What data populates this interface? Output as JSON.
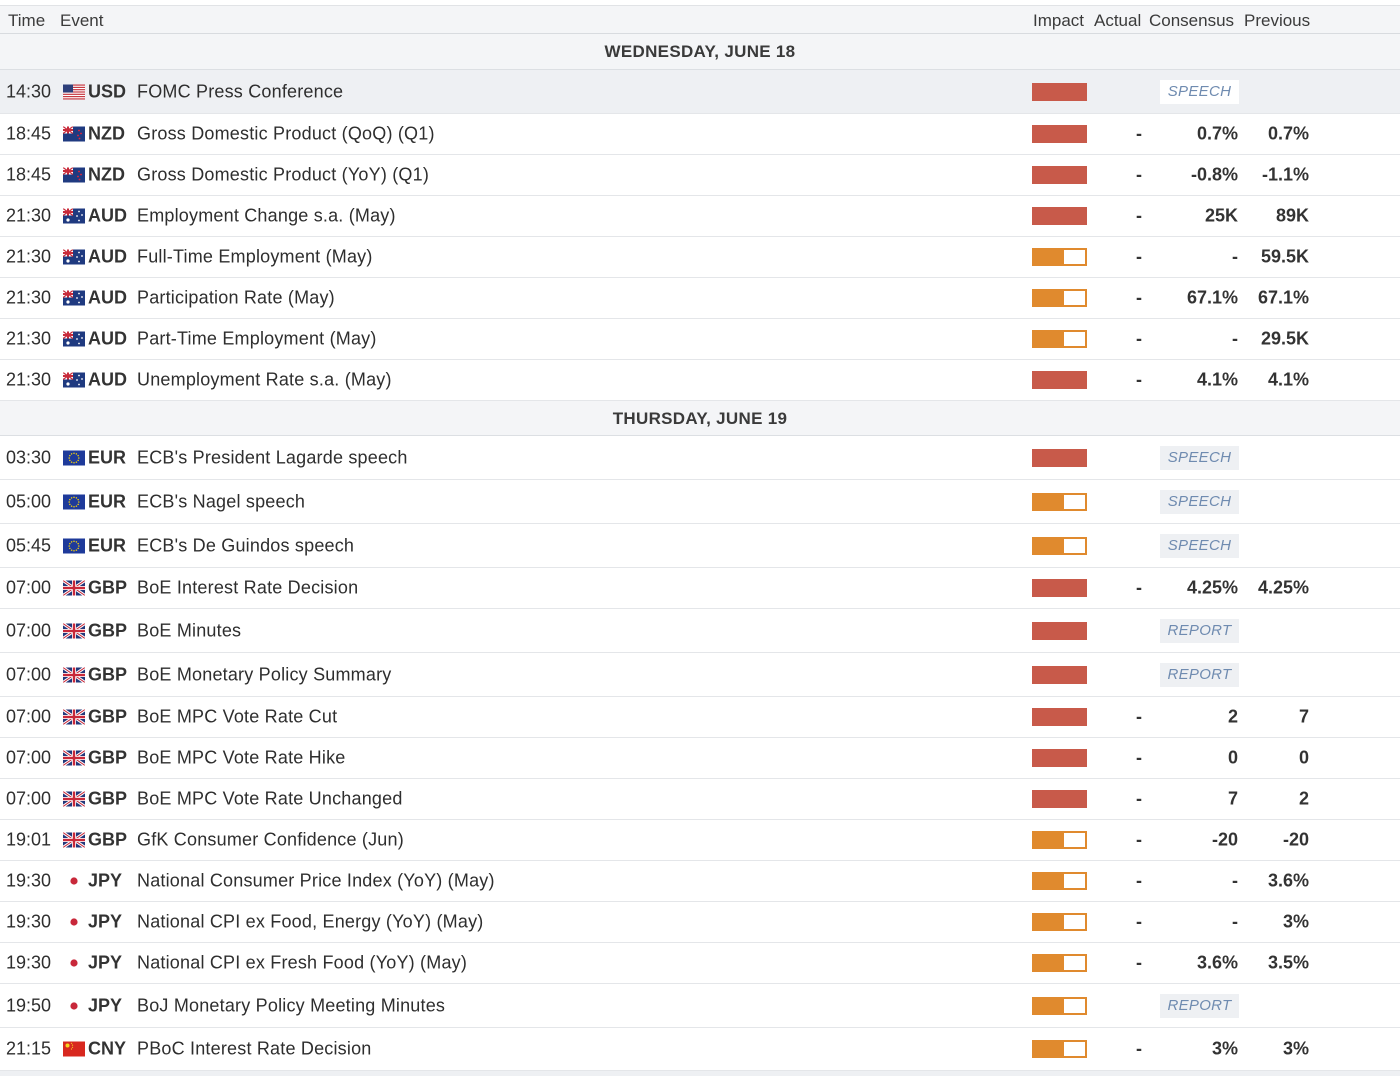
{
  "header": {
    "time": "Time",
    "event": "Event",
    "impact": "Impact",
    "actual": "Actual",
    "consensus": "Consensus",
    "previous": "Previous"
  },
  "colors": {
    "high_impact": "#c85a4a",
    "medium_impact": "#e08a2e",
    "tag_text": "#6f8bb0"
  },
  "days": [
    {
      "label": "WEDNESDAY, JUNE 18",
      "events": [
        {
          "time": "14:30",
          "flag": "us-flag-icon",
          "currency": "USD",
          "event": "FOMC Press Conference",
          "impact": "high",
          "actual": "",
          "consensus": "",
          "previous": "",
          "tag": "SPEECH",
          "highlighted": true
        },
        {
          "time": "18:45",
          "flag": "nz-flag-icon",
          "currency": "NZD",
          "event": "Gross Domestic Product (QoQ) (Q1)",
          "impact": "high",
          "actual": "-",
          "consensus": "0.7%",
          "previous": "0.7%",
          "tag": ""
        },
        {
          "time": "18:45",
          "flag": "nz-flag-icon",
          "currency": "NZD",
          "event": "Gross Domestic Product (YoY) (Q1)",
          "impact": "high",
          "actual": "-",
          "consensus": "-0.8%",
          "previous": "-1.1%",
          "tag": ""
        },
        {
          "time": "21:30",
          "flag": "au-flag-icon",
          "currency": "AUD",
          "event": "Employment Change s.a. (May)",
          "impact": "high",
          "actual": "-",
          "consensus": "25K",
          "previous": "89K",
          "tag": ""
        },
        {
          "time": "21:30",
          "flag": "au-flag-icon",
          "currency": "AUD",
          "event": "Full-Time Employment (May)",
          "impact": "medium",
          "actual": "-",
          "consensus": "-",
          "previous": "59.5K",
          "tag": ""
        },
        {
          "time": "21:30",
          "flag": "au-flag-icon",
          "currency": "AUD",
          "event": "Participation Rate (May)",
          "impact": "medium",
          "actual": "-",
          "consensus": "67.1%",
          "previous": "67.1%",
          "tag": ""
        },
        {
          "time": "21:30",
          "flag": "au-flag-icon",
          "currency": "AUD",
          "event": "Part-Time Employment (May)",
          "impact": "medium",
          "actual": "-",
          "consensus": "-",
          "previous": "29.5K",
          "tag": ""
        },
        {
          "time": "21:30",
          "flag": "au-flag-icon",
          "currency": "AUD",
          "event": "Unemployment Rate s.a. (May)",
          "impact": "high",
          "actual": "-",
          "consensus": "4.1%",
          "previous": "4.1%",
          "tag": ""
        }
      ]
    },
    {
      "label": "THURSDAY, JUNE 19",
      "events": [
        {
          "time": "03:30",
          "flag": "eu-flag-icon",
          "currency": "EUR",
          "event": "ECB's President Lagarde speech",
          "impact": "high",
          "actual": "",
          "consensus": "",
          "previous": "",
          "tag": "SPEECH"
        },
        {
          "time": "05:00",
          "flag": "eu-flag-icon",
          "currency": "EUR",
          "event": "ECB's Nagel speech",
          "impact": "medium",
          "actual": "",
          "consensus": "",
          "previous": "",
          "tag": "SPEECH"
        },
        {
          "time": "05:45",
          "flag": "eu-flag-icon",
          "currency": "EUR",
          "event": "ECB's De Guindos speech",
          "impact": "medium",
          "actual": "",
          "consensus": "",
          "previous": "",
          "tag": "SPEECH"
        },
        {
          "time": "07:00",
          "flag": "uk-flag-icon",
          "currency": "GBP",
          "event": "BoE Interest Rate Decision",
          "impact": "high",
          "actual": "-",
          "consensus": "4.25%",
          "previous": "4.25%",
          "tag": ""
        },
        {
          "time": "07:00",
          "flag": "uk-flag-icon",
          "currency": "GBP",
          "event": "BoE Minutes",
          "impact": "high",
          "actual": "",
          "consensus": "",
          "previous": "",
          "tag": "REPORT"
        },
        {
          "time": "07:00",
          "flag": "uk-flag-icon",
          "currency": "GBP",
          "event": "BoE Monetary Policy Summary",
          "impact": "high",
          "actual": "",
          "consensus": "",
          "previous": "",
          "tag": "REPORT"
        },
        {
          "time": "07:00",
          "flag": "uk-flag-icon",
          "currency": "GBP",
          "event": "BoE MPC Vote Rate Cut",
          "impact": "high",
          "actual": "-",
          "consensus": "2",
          "previous": "7",
          "tag": ""
        },
        {
          "time": "07:00",
          "flag": "uk-flag-icon",
          "currency": "GBP",
          "event": "BoE MPC Vote Rate Hike",
          "impact": "high",
          "actual": "-",
          "consensus": "0",
          "previous": "0",
          "tag": ""
        },
        {
          "time": "07:00",
          "flag": "uk-flag-icon",
          "currency": "GBP",
          "event": "BoE MPC Vote Rate Unchanged",
          "impact": "high",
          "actual": "-",
          "consensus": "7",
          "previous": "2",
          "tag": ""
        },
        {
          "time": "19:01",
          "flag": "uk-flag-icon",
          "currency": "GBP",
          "event": "GfK Consumer Confidence (Jun)",
          "impact": "medium",
          "actual": "-",
          "consensus": "-20",
          "previous": "-20",
          "tag": ""
        },
        {
          "time": "19:30",
          "flag": "jp-flag-icon",
          "currency": "JPY",
          "event": "National Consumer Price Index (YoY) (May)",
          "impact": "medium",
          "actual": "-",
          "consensus": "-",
          "previous": "3.6%",
          "tag": ""
        },
        {
          "time": "19:30",
          "flag": "jp-flag-icon",
          "currency": "JPY",
          "event": "National CPI ex Food, Energy (YoY) (May)",
          "impact": "medium",
          "actual": "-",
          "consensus": "-",
          "previous": "3%",
          "tag": ""
        },
        {
          "time": "19:30",
          "flag": "jp-flag-icon",
          "currency": "JPY",
          "event": "National CPI ex Fresh Food (YoY) (May)",
          "impact": "medium",
          "actual": "-",
          "consensus": "3.6%",
          "previous": "3.5%",
          "tag": ""
        },
        {
          "time": "19:50",
          "flag": "jp-flag-icon",
          "currency": "JPY",
          "event": "BoJ Monetary Policy Meeting Minutes",
          "impact": "medium",
          "actual": "",
          "consensus": "",
          "previous": "",
          "tag": "REPORT"
        },
        {
          "time": "21:15",
          "flag": "cn-flag-icon",
          "currency": "CNY",
          "event": "PBoC Interest Rate Decision",
          "impact": "medium",
          "actual": "-",
          "consensus": "3%",
          "previous": "3%",
          "tag": ""
        }
      ]
    }
  ]
}
